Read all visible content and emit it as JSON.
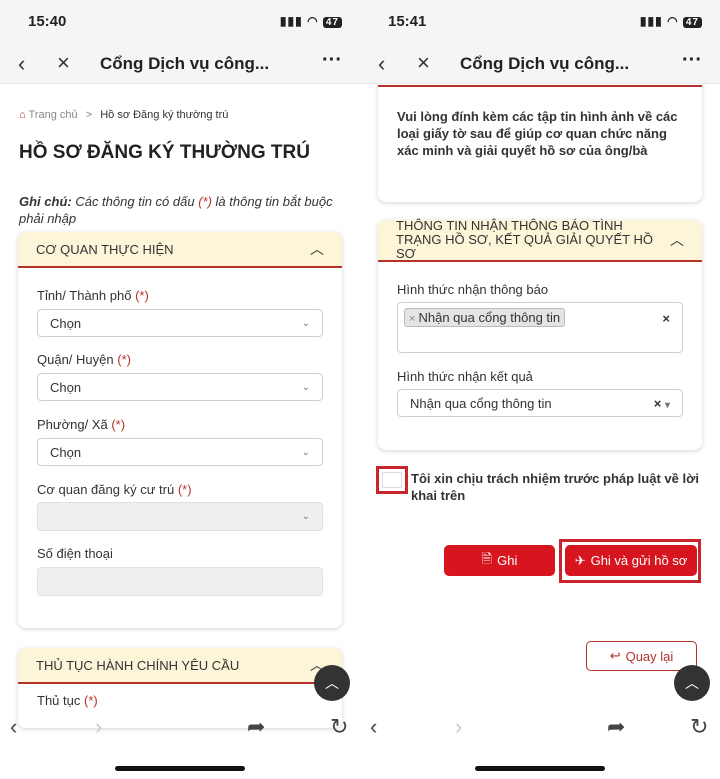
{
  "left": {
    "status": {
      "time": "15:40",
      "battery": "47"
    },
    "header": {
      "title": "Cổng Dịch vụ công..."
    },
    "breadcrumb": {
      "home": "Trang chủ",
      "separator": ">",
      "current": "Hồ sơ Đăng ký thường trú"
    },
    "page_title": "HỒ SƠ ĐĂNG KÝ THƯỜNG TRÚ",
    "note": {
      "label": "Ghi chú:",
      "text_before": " Các thông tin có dấu ",
      "mark": "(*)",
      "text_after": " là thông tin bắt buộc phải nhập"
    },
    "section1": {
      "title": "CƠ QUAN THỰC HIỆN",
      "fields": [
        {
          "label": "Tỉnh/ Thành phố",
          "required": "(*)",
          "value": "Chọn"
        },
        {
          "label": "Quận/ Huyện",
          "required": "(*)",
          "value": "Chọn"
        },
        {
          "label": "Phường/ Xã",
          "required": "(*)",
          "value": "Chọn"
        },
        {
          "label": "Cơ quan đăng ký cư trú",
          "required": "(*)",
          "value": ""
        },
        {
          "label": "Số điện thoại",
          "required": "",
          "value": ""
        }
      ]
    },
    "section2": {
      "title": "THỦ TỤC HÀNH CHÍNH YÊU CẦU",
      "first_label": "Thủ tục",
      "required": "(*)"
    }
  },
  "right": {
    "status": {
      "time": "15:41",
      "battery": "47"
    },
    "header": {
      "title": "Cổng Dịch vụ công..."
    },
    "attach_note": "Vui lòng đính kèm các tập tin hình ảnh về các loại giấy tờ sau để giúp cơ quan chức năng xác minh và giải quyết hồ sơ của ông/bà",
    "section": {
      "title": "THÔNG TIN NHẬN THÔNG BÁO TÌNH TRẠNG HỒ SƠ, KẾT QUẢ GIẢI QUYẾT HỒ SƠ",
      "notify_label": "Hình thức nhận thông báo",
      "notify_tag": "Nhận qua cổng thông tin",
      "result_label": "Hình thức nhận kết quả",
      "result_value": "Nhận qua cổng thông tin"
    },
    "agreement": {
      "text": "Tôi xin chịu trách nhiệm trước pháp luật về lời khai trên",
      "checked": false
    },
    "buttons": {
      "save": "Ghi",
      "save_submit": "Ghi và gửi hồ sơ",
      "back": "Quay lại"
    }
  },
  "colors": {
    "accent": "#d6151f",
    "section_bg": "#fdf5d8",
    "section_border": "#b5312b"
  }
}
